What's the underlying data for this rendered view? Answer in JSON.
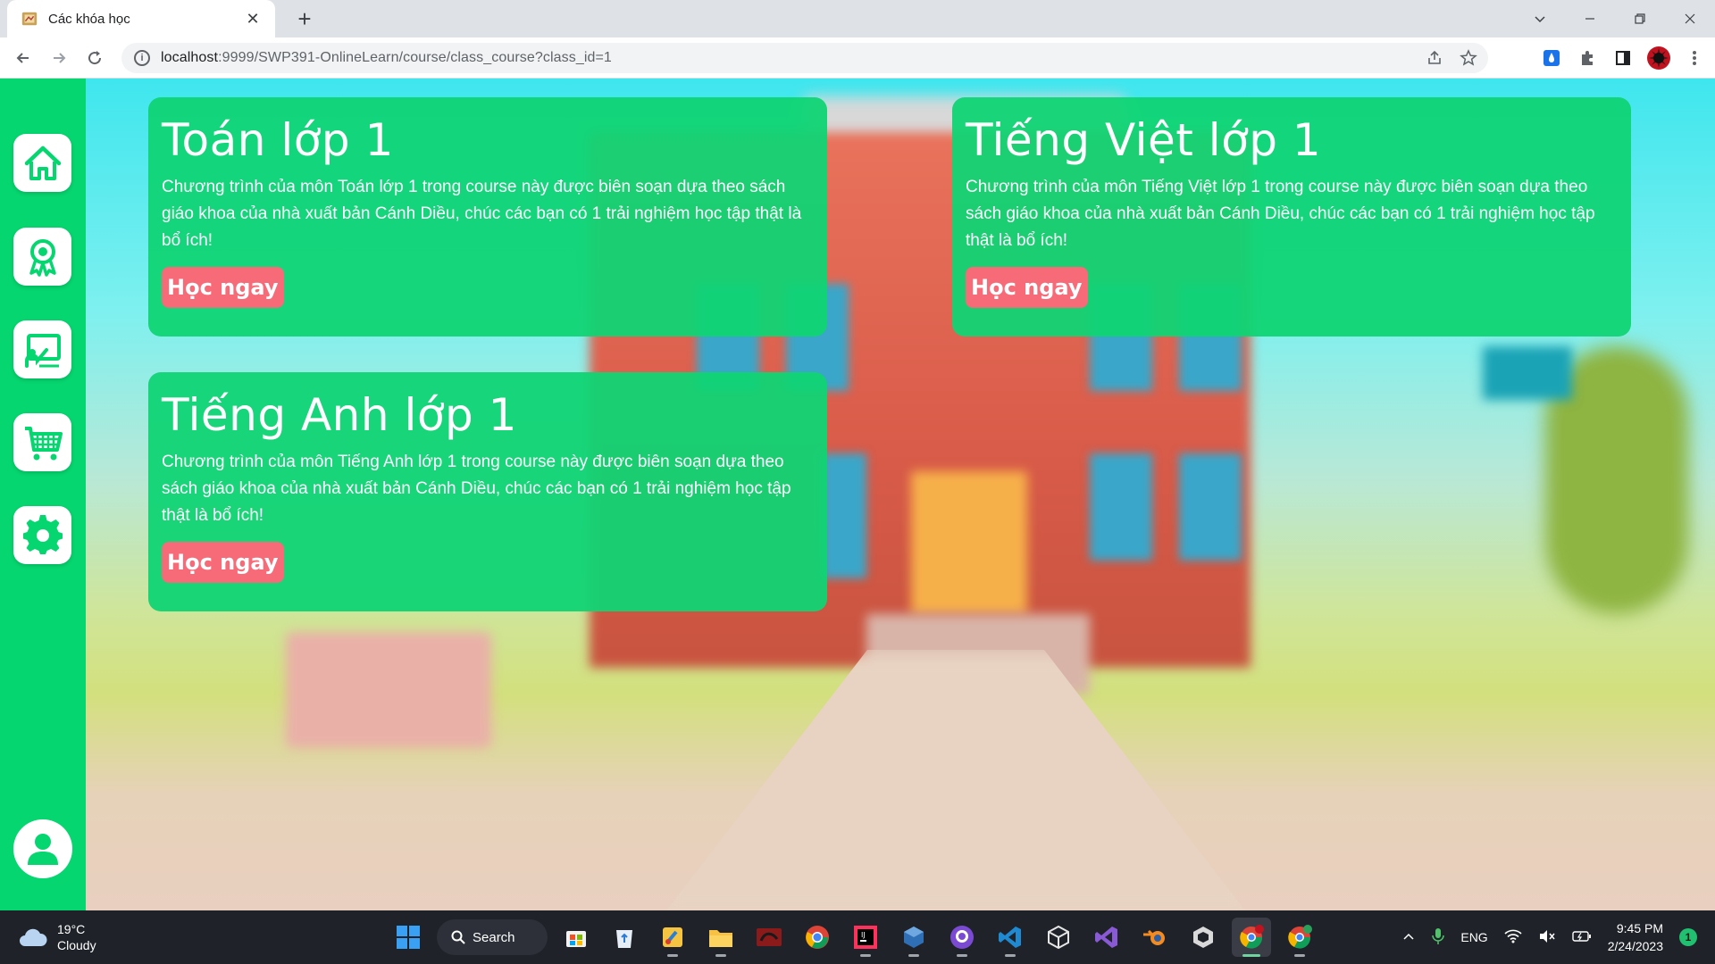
{
  "browser": {
    "tab_title": "Các khóa học",
    "tab_close": "✕",
    "new_tab": "+",
    "url_host": "localhost",
    "url_rest": ":9999/SWP391-OnlineLearn/course/class_course?class_id=1"
  },
  "sidebar": {
    "items": [
      "home-icon",
      "award-icon",
      "teacher-board-icon",
      "cart-icon",
      "settings-icon"
    ],
    "user": "user-icon"
  },
  "courses": [
    {
      "title": "Toán lớp 1",
      "description": "Chương trình của môn Toán lớp 1 trong course này được biên soạn dựa theo sách giáo khoa của nhà xuất bản Cánh Diều, chúc các bạn có 1 trải nghiệm học tập thật là bổ ích!",
      "button": "Học ngay"
    },
    {
      "title": "Tiếng Việt lớp 1",
      "description": "Chương trình của môn Tiếng Việt lớp 1 trong course này được biên soạn dựa theo sách giáo khoa của nhà xuất bản Cánh Diều, chúc các bạn có 1 trải nghiệm học tập thật là bổ ích!",
      "button": "Học ngay"
    },
    {
      "title": "Tiếng Anh lớp 1",
      "description": "Chương trình của môn Tiếng Anh lớp 1 trong course này được biên soạn dựa theo sách giáo khoa của nhà xuất bản Cánh Diều, chúc các bạn có 1 trải nghiệm học tập thật là bổ ích!",
      "button": "Học ngay"
    }
  ],
  "taskbar": {
    "weather_temp": "19°C",
    "weather_desc": "Cloudy",
    "search_label": "Search",
    "language": "ENG",
    "time": "9:45 PM",
    "date": "2/24/2023",
    "notification_count": "1"
  },
  "colors": {
    "sidebar": "#06d66f",
    "card": "#10d474",
    "button": "#f76a78"
  }
}
